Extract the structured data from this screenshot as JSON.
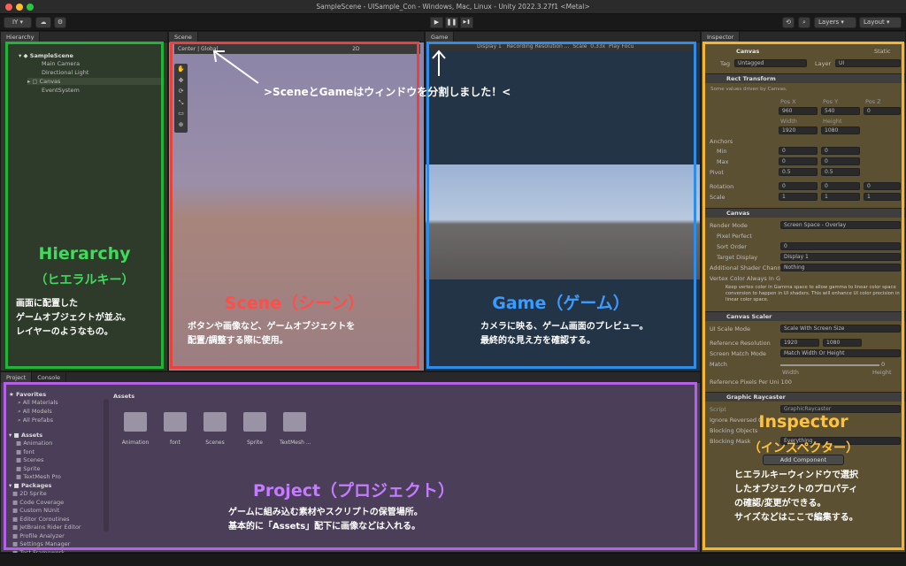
{
  "window": {
    "title": "SampleScene - UISample_Con - Windows, Mac, Linux - Unity 2022.3.27f1 <Metal>"
  },
  "toolbar": {
    "account": "IY ▾",
    "play": "▶",
    "pause": "❚❚",
    "step": "▶❚",
    "layers": "Layers",
    "layout": "Layout"
  },
  "hierarchy": {
    "tab": "Hierarchy",
    "scene": "SampleScene",
    "items": [
      "Main Camera",
      "Directional Light",
      "Canvas",
      "EventSystem"
    ]
  },
  "scene": {
    "tab": "Scene",
    "center": "Center",
    "global": "Global",
    "mode2d": "2D"
  },
  "game": {
    "tab": "Game",
    "display": "Display 1",
    "resolution": "Recording Resolution ...",
    "scale": "Scale",
    "scale_val": "0.33x",
    "play_focused": "Play Focu"
  },
  "annot": {
    "arrow_note": ">SceneとGameはウィンドウを分割しました！<",
    "hierarchy_title": "Hierarchy",
    "hierarchy_sub": "（ヒエラルキー）",
    "hierarchy_desc": [
      "画面に配置した",
      "ゲームオブジェクトが並ぶ。",
      "レイヤーのようなもの。"
    ],
    "scene_title": "Scene（シーン）",
    "scene_desc": [
      "ボタンや画像など、ゲームオブジェクトを",
      "配置/調整する際に使用。"
    ],
    "game_title": "Game（ゲーム）",
    "game_desc": [
      "カメラに映る、ゲーム画面のプレビュー。",
      "最終的な見え方を確認する。"
    ],
    "project_title": "Project（プロジェクト）",
    "project_desc": [
      "ゲームに組み込む素材やスクリプトの保管場所。",
      "基本的に「Assets」配下に画像などは入れる。"
    ],
    "inspector_title": "Inspector",
    "inspector_sub": "（インスペクター）",
    "inspector_desc": [
      "ヒエラルキーウィンドウで選択",
      "したオブジェクトのプロパティ",
      "の確認/変更ができる。",
      "サイズなどはここで編集する。"
    ]
  },
  "colors": {
    "green": "#22b43a",
    "red": "#e8423f",
    "blue": "#2f8ce8",
    "purple": "#b461e8",
    "yellow": "#f5b52e"
  },
  "project": {
    "tab": "Project",
    "console_tab": "Console",
    "favorites": "Favorites",
    "fav_items": [
      "All Materials",
      "All Models",
      "All Prefabs"
    ],
    "assets": "Assets",
    "asset_items": [
      "Animation",
      "font",
      "Scenes",
      "Sprite",
      "TextMesh Pro"
    ],
    "packages": "Packages",
    "package_items": [
      "2D Sprite",
      "Code Coverage",
      "Custom NUnit",
      "Editor Coroutines",
      "JetBrains Rider Editor",
      "Profile Analyzer",
      "Settings Manager",
      "Test Framework"
    ],
    "breadcrumb": "Assets",
    "folders": [
      "Animation",
      "font",
      "Scenes",
      "Sprite",
      "TextMesh ..."
    ]
  },
  "inspector": {
    "tab": "Inspector",
    "name": "Canvas",
    "static": "Static",
    "tag_label": "Tag",
    "tag": "Untagged",
    "layer_label": "Layer",
    "layer": "UI",
    "rect": {
      "title": "Rect Transform",
      "note": "Some values driven by Canvas.",
      "posx": "Pos X",
      "posy": "Pos Y",
      "posz": "Pos Z",
      "px": "960",
      "py": "540",
      "pz": "0",
      "width": "Width",
      "height": "Height",
      "w": "1920",
      "h": "1080",
      "anchors": "Anchors",
      "min": "Min",
      "max": "Max",
      "pivot": "Pivot",
      "rotation": "Rotation",
      "scale": "Scale",
      "x": "X",
      "y": "Y",
      "z": "Z",
      "v0": "0",
      "v1": "1",
      "v05": "0.5"
    },
    "canvas": {
      "title": "Canvas",
      "render_mode": "Render Mode",
      "render_val": "Screen Space - Overlay",
      "pixel_perfect": "Pixel Perfect",
      "sort_order": "Sort Order",
      "sort_val": "0",
      "target_display": "Target Display",
      "display_val": "Display 1",
      "shader": "Additional Shader Chann",
      "shader_val": "Nothing",
      "vertex": "Vertex Color Always In G",
      "help": "Keep vertex color in Gamma space to allow gamma to linear color space conversion to happen in UI shaders. This will enhance UI color precision in linear color space."
    },
    "scaler": {
      "title": "Canvas Scaler",
      "ui_scale": "UI Scale Mode",
      "ui_scale_val": "Scale With Screen Size",
      "ref_res": "Reference Resolution",
      "rx": "1920",
      "ry": "1080",
      "match_mode": "Screen Match Mode",
      "match_mode_val": "Match Width Or Height",
      "match": "Match",
      "match_val": "0",
      "width": "Width",
      "height": "Height",
      "ppu": "Reference Pixels Per Uni",
      "ppu_val": "100"
    },
    "raycaster": {
      "title": "Graphic Raycaster",
      "script": "Script",
      "script_val": "GraphicRaycaster",
      "ignore": "Ignore Reversed G",
      "blocking": "Blocking Objects",
      "mask": "Blocking Mask",
      "mask_val": "Everything"
    },
    "add_component": "Add Component"
  }
}
